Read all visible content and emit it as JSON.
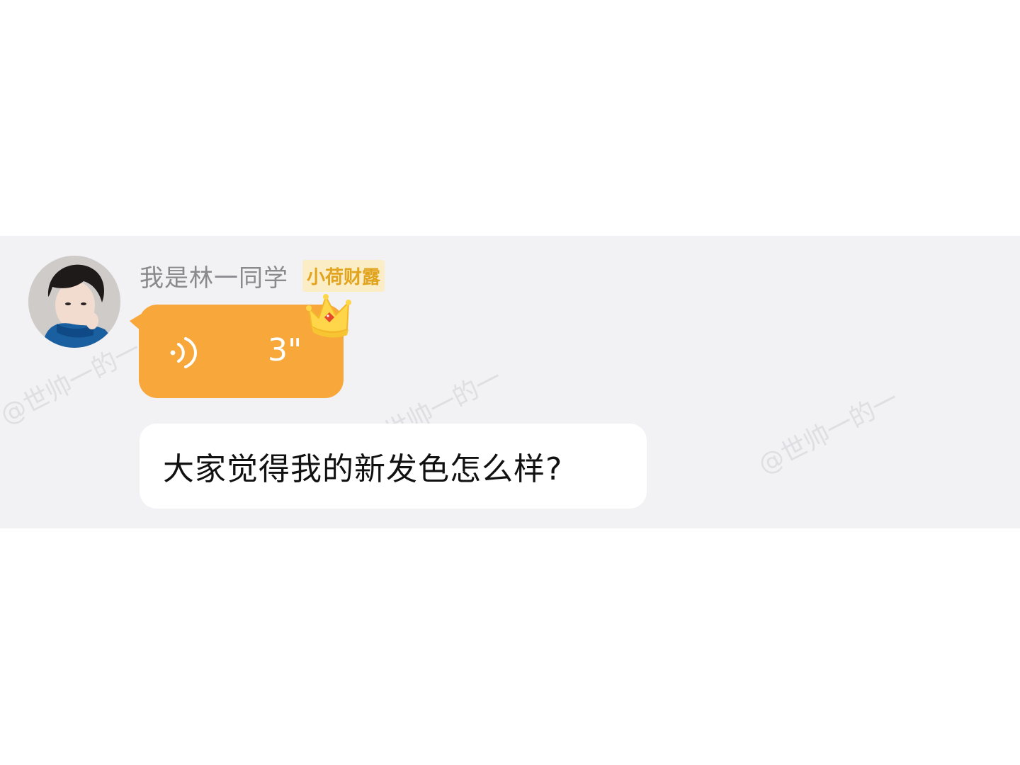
{
  "chat": {
    "sender": {
      "name": "我是林一同学",
      "title_badge": "小荷财露"
    },
    "messages": [
      {
        "type": "voice",
        "duration": "3\"",
        "bubble_color": "#f8a73a"
      },
      {
        "type": "text",
        "text": "大家觉得我的新发色怎么样?"
      }
    ]
  },
  "watermark": {
    "text": "@世帅一的一"
  },
  "colors": {
    "band_background": "#f2f1f4",
    "badge_text": "#e2a41e",
    "badge_background": "#fbeec6",
    "voice_bubble": "#f8a73a"
  },
  "icons": {
    "avatar": "avatar-photo",
    "voice": "voice-wave-icon",
    "crown": "crown-icon"
  }
}
